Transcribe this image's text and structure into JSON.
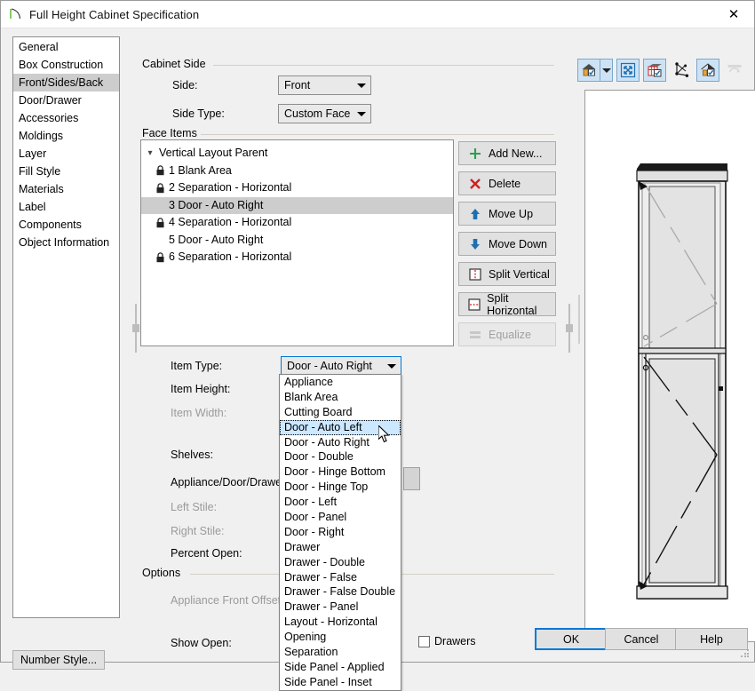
{
  "window": {
    "title": "Full Height Cabinet Specification",
    "icon": "cabinet-icon",
    "close_label": "✕"
  },
  "sidebar": {
    "items": [
      {
        "label": "General",
        "selected": false
      },
      {
        "label": "Box Construction",
        "selected": false
      },
      {
        "label": "Front/Sides/Back",
        "selected": true
      },
      {
        "label": "Door/Drawer",
        "selected": false
      },
      {
        "label": "Accessories",
        "selected": false
      },
      {
        "label": "Moldings",
        "selected": false
      },
      {
        "label": "Layer",
        "selected": false
      },
      {
        "label": "Fill Style",
        "selected": false
      },
      {
        "label": "Materials",
        "selected": false
      },
      {
        "label": "Label",
        "selected": false
      },
      {
        "label": "Components",
        "selected": false
      },
      {
        "label": "Object Information",
        "selected": false
      }
    ],
    "number_style_button": "Number Style..."
  },
  "cabinet_side": {
    "group_title": "Cabinet Side",
    "side_label": "Side:",
    "side_value": "Front",
    "side_type_label": "Side Type:",
    "side_type_value": "Custom Face"
  },
  "face_items": {
    "group_title": "Face Items",
    "tree": [
      {
        "label": "Vertical Layout Parent",
        "depth": 0,
        "chevron": "⌄",
        "lock": false,
        "selected": false
      },
      {
        "label": "1 Blank Area",
        "depth": 1,
        "chevron": "",
        "lock": true,
        "selected": false
      },
      {
        "label": "2 Separation - Horizontal",
        "depth": 1,
        "chevron": "",
        "lock": true,
        "selected": false
      },
      {
        "label": "3 Door - Auto Right",
        "depth": 1,
        "chevron": "",
        "lock": false,
        "selected": true
      },
      {
        "label": "4 Separation - Horizontal",
        "depth": 1,
        "chevron": "",
        "lock": true,
        "selected": false
      },
      {
        "label": "5 Door - Auto Right",
        "depth": 1,
        "chevron": "",
        "lock": false,
        "selected": false
      },
      {
        "label": "6 Separation - Horizontal",
        "depth": 1,
        "chevron": "",
        "lock": true,
        "selected": false
      }
    ],
    "buttons": [
      {
        "label": "Add New...",
        "icon": "plus-icon",
        "enabled": true
      },
      {
        "label": "Delete",
        "icon": "x-icon",
        "enabled": true
      },
      {
        "label": "Move Up",
        "icon": "arrow-up-icon",
        "enabled": true
      },
      {
        "label": "Move Down",
        "icon": "arrow-down-icon",
        "enabled": true
      },
      {
        "label": "Split Vertical",
        "icon": "split-vertical-icon",
        "enabled": true
      },
      {
        "label": "Split Horizontal",
        "icon": "split-horizontal-icon",
        "enabled": true
      },
      {
        "label": "Equalize",
        "icon": "equalize-icon",
        "enabled": false
      }
    ]
  },
  "item_properties": {
    "item_type_label": "Item Type:",
    "item_type_value": "Door - Auto Right",
    "item_height_label": "Item Height:",
    "item_width_label": "Item Width:",
    "item_width_disabled": true,
    "shelves_label": "Shelves:",
    "appliance_door_drawer_label": "Appliance/Door/Drawer:",
    "left_stile_label": "Left Stile:",
    "left_stile_disabled": true,
    "right_stile_label": "Right Stile:",
    "right_stile_disabled": true,
    "percent_open_label": "Percent Open:"
  },
  "item_type_dropdown": {
    "open": true,
    "options": [
      "Appliance",
      "Blank Area",
      "Cutting Board",
      "Door - Auto Left",
      "Door - Auto Right",
      "Door - Double",
      "Door - Hinge Bottom",
      "Door - Hinge Top",
      "Door - Left",
      "Door - Panel",
      "Door - Right",
      "Drawer",
      "Drawer - Double",
      "Drawer - False",
      "Drawer - False Double",
      "Drawer - Panel",
      "Layout - Horizontal",
      "Opening",
      "Separation",
      "Side Panel - Applied",
      "Side Panel - Inset"
    ],
    "highlighted": "Door - Auto Left"
  },
  "options": {
    "group_title": "Options",
    "appliance_front_offset_label": "Appliance Front Offset:",
    "appliance_front_offset_disabled": true,
    "show_open_label": "Show Open:",
    "drawers_checkbox_label": "Drawers",
    "drawers_checked": false
  },
  "preview_toolbar": {
    "buttons": [
      {
        "name": "view-mode-house-icon",
        "active": true,
        "has_dropdown": true
      },
      {
        "name": "fill-window-icon",
        "active": true,
        "has_dropdown": false
      },
      {
        "name": "dimension-view-icon",
        "active": true,
        "has_dropdown": false
      },
      {
        "name": "orbit-camera-icon",
        "active": false,
        "has_dropdown": false
      },
      {
        "name": "glass-house-icon",
        "active": true,
        "has_dropdown": false
      },
      {
        "name": "rotate-icon",
        "active": false,
        "has_dropdown": false,
        "disabled": true
      }
    ]
  },
  "footer": {
    "ok_label": "OK",
    "cancel_label": "Cancel",
    "help_label": "Help"
  },
  "colors": {
    "accent": "#0078d7",
    "selection": "#cce8ff",
    "list_selection": "#cdcdcd",
    "dialog_bg": "#f0f0f0",
    "control_bg": "#e1e1e1",
    "border": "#8d8d8d",
    "green": "#2e9e4f",
    "red": "#cc2222",
    "blue": "#1f6fb0"
  }
}
